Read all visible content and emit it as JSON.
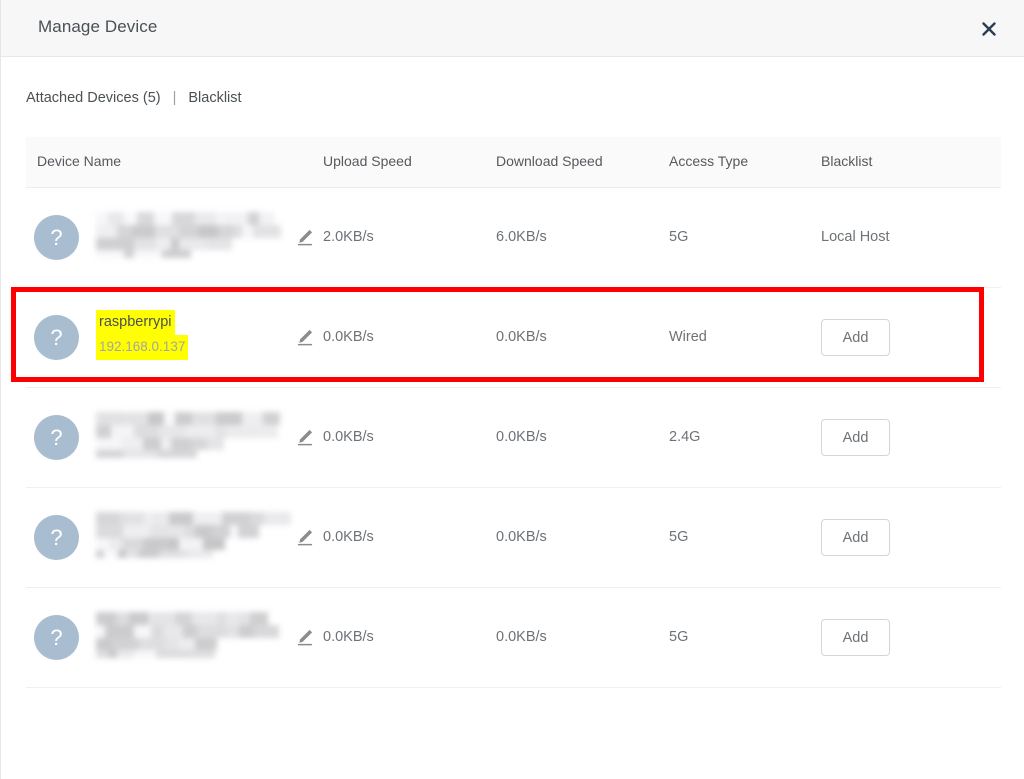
{
  "dialog": {
    "title": "Manage Device",
    "close_icon": "close-icon"
  },
  "tabs": {
    "attached_label": "Attached Devices (5)",
    "separator": "|",
    "blacklist_label": "Blacklist"
  },
  "table": {
    "headers": {
      "device_name": "Device Name",
      "upload_speed": "Upload Speed",
      "download_speed": "Download Speed",
      "access_type": "Access Type",
      "blacklist": "Blacklist"
    },
    "rows": [
      {
        "avatar": "?",
        "name": "",
        "ip": "",
        "redacted": true,
        "highlighted": false,
        "upload_speed": "2.0KB/s",
        "download_speed": "6.0KB/s",
        "access_type": "5G",
        "blacklist_text": "Local Host",
        "blacklist_is_button": false
      },
      {
        "avatar": "?",
        "name": "raspberrypi",
        "ip": "192.168.0.137",
        "redacted": false,
        "highlighted": true,
        "upload_speed": "0.0KB/s",
        "download_speed": "0.0KB/s",
        "access_type": "Wired",
        "blacklist_text": "Add",
        "blacklist_is_button": true
      },
      {
        "avatar": "?",
        "name": "",
        "ip": "",
        "redacted": true,
        "highlighted": false,
        "upload_speed": "0.0KB/s",
        "download_speed": "0.0KB/s",
        "access_type": "2.4G",
        "blacklist_text": "Add",
        "blacklist_is_button": true
      },
      {
        "avatar": "?",
        "name": "",
        "ip": "",
        "redacted": true,
        "highlighted": false,
        "upload_speed": "0.0KB/s",
        "download_speed": "0.0KB/s",
        "access_type": "5G",
        "blacklist_text": "Add",
        "blacklist_is_button": true
      },
      {
        "avatar": "?",
        "name": "",
        "ip": "",
        "redacted": true,
        "highlighted": false,
        "upload_speed": "0.0KB/s",
        "download_speed": "0.0KB/s",
        "access_type": "5G",
        "blacklist_text": "Add",
        "blacklist_is_button": true
      }
    ],
    "edit_icon": "pencil-icon"
  },
  "annotation": {
    "color": "#ff0000",
    "target_row_index": 1
  },
  "colors": {
    "avatar_bg": "#a9bdd0",
    "highlight": "#ffff00",
    "titlebar_bg": "#f7f7f7",
    "header_bg": "#fafafa",
    "annotation_red": "#ff0000"
  }
}
